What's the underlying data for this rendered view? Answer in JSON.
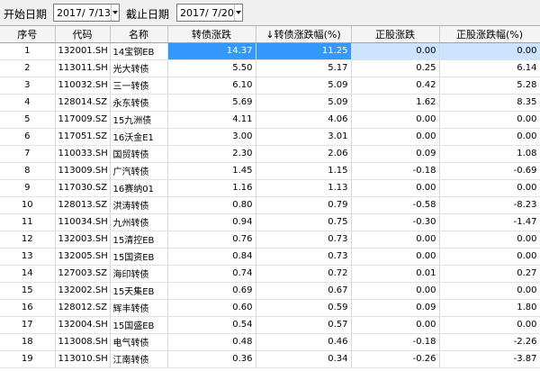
{
  "toolbar": {
    "start_label": "开始日期",
    "start_date": "2017/ 7/13",
    "end_label": "截止日期",
    "end_date": "2017/ 7/20"
  },
  "columns": [
    "序号",
    "代码",
    "名称",
    "转债涨跌",
    "↓转债涨跌幅(%)",
    "正股涨跌",
    "正股涨跌幅(%)"
  ],
  "rows": [
    {
      "seq": "1",
      "code": "132001.SH",
      "name": "14宝钢EB",
      "cb_change": "14.37",
      "cb_pct": "11.25",
      "stock_change": "0.00",
      "stock_pct": "0.00"
    },
    {
      "seq": "2",
      "code": "113011.SH",
      "name": "光大转债",
      "cb_change": "5.50",
      "cb_pct": "5.17",
      "stock_change": "0.25",
      "stock_pct": "6.14"
    },
    {
      "seq": "3",
      "code": "110032.SH",
      "name": "三一转债",
      "cb_change": "6.10",
      "cb_pct": "5.09",
      "stock_change": "0.42",
      "stock_pct": "5.28"
    },
    {
      "seq": "4",
      "code": "128014.SZ",
      "name": "永东转债",
      "cb_change": "5.69",
      "cb_pct": "5.09",
      "stock_change": "1.62",
      "stock_pct": "8.35"
    },
    {
      "seq": "5",
      "code": "117009.SZ",
      "name": "15九洲债",
      "cb_change": "4.11",
      "cb_pct": "4.06",
      "stock_change": "0.00",
      "stock_pct": "0.00"
    },
    {
      "seq": "6",
      "code": "117051.SZ",
      "name": "16沃金E1",
      "cb_change": "3.00",
      "cb_pct": "3.01",
      "stock_change": "0.00",
      "stock_pct": "0.00"
    },
    {
      "seq": "7",
      "code": "110033.SH",
      "name": "国贸转债",
      "cb_change": "2.30",
      "cb_pct": "2.06",
      "stock_change": "0.09",
      "stock_pct": "1.08"
    },
    {
      "seq": "8",
      "code": "113009.SH",
      "name": "广汽转债",
      "cb_change": "1.45",
      "cb_pct": "1.15",
      "stock_change": "-0.18",
      "stock_pct": "-0.69"
    },
    {
      "seq": "9",
      "code": "117030.SZ",
      "name": "16赛纳01",
      "cb_change": "1.16",
      "cb_pct": "1.13",
      "stock_change": "0.00",
      "stock_pct": "0.00"
    },
    {
      "seq": "10",
      "code": "128013.SZ",
      "name": "洪涛转债",
      "cb_change": "0.80",
      "cb_pct": "0.79",
      "stock_change": "-0.58",
      "stock_pct": "-8.23"
    },
    {
      "seq": "11",
      "code": "110034.SH",
      "name": "九州转债",
      "cb_change": "0.94",
      "cb_pct": "0.75",
      "stock_change": "-0.30",
      "stock_pct": "-1.47"
    },
    {
      "seq": "12",
      "code": "132003.SH",
      "name": "15清控EB",
      "cb_change": "0.76",
      "cb_pct": "0.73",
      "stock_change": "0.00",
      "stock_pct": "0.00"
    },
    {
      "seq": "13",
      "code": "132005.SH",
      "name": "15国资EB",
      "cb_change": "0.84",
      "cb_pct": "0.73",
      "stock_change": "0.00",
      "stock_pct": "0.00"
    },
    {
      "seq": "14",
      "code": "127003.SZ",
      "name": "海印转债",
      "cb_change": "0.74",
      "cb_pct": "0.72",
      "stock_change": "0.01",
      "stock_pct": "0.27"
    },
    {
      "seq": "15",
      "code": "132002.SH",
      "name": "15天集EB",
      "cb_change": "0.69",
      "cb_pct": "0.67",
      "stock_change": "0.00",
      "stock_pct": "0.00"
    },
    {
      "seq": "16",
      "code": "128012.SZ",
      "name": "辉丰转债",
      "cb_change": "0.60",
      "cb_pct": "0.59",
      "stock_change": "0.09",
      "stock_pct": "1.80"
    },
    {
      "seq": "17",
      "code": "132004.SH",
      "name": "15国盛EB",
      "cb_change": "0.54",
      "cb_pct": "0.57",
      "stock_change": "0.00",
      "stock_pct": "0.00"
    },
    {
      "seq": "18",
      "code": "113008.SH",
      "name": "电气转债",
      "cb_change": "0.48",
      "cb_pct": "0.46",
      "stock_change": "-0.18",
      "stock_pct": "-2.26"
    },
    {
      "seq": "19",
      "code": "113010.SH",
      "name": "江南转债",
      "cb_change": "0.36",
      "cb_pct": "0.34",
      "stock_change": "-0.26",
      "stock_pct": "-3.87"
    }
  ],
  "colors": {
    "selection": "#3399ff",
    "selection_light": "#cce4ff",
    "header_bg": "#f4f4f4"
  }
}
